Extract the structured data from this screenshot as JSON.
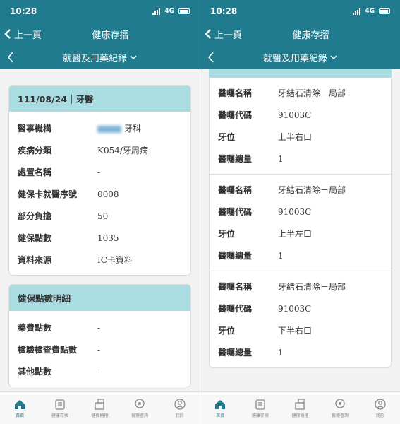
{
  "status": {
    "time": "10:28",
    "network": "4G"
  },
  "nav": {
    "back_label": "上一頁",
    "title": "健康存摺",
    "subtitle": "就醫及用藥紀錄"
  },
  "visit": {
    "header": "111/08/24｜牙醫",
    "fields": [
      {
        "label": "醫事機構",
        "value": "牙科"
      },
      {
        "label": "疾病分類",
        "value": "K054/牙周病"
      },
      {
        "label": "處置名稱",
        "value": "-"
      },
      {
        "label": "健保卡就醫序號",
        "value": "0008"
      },
      {
        "label": "部分負擔",
        "value": "50"
      },
      {
        "label": "健保點數",
        "value": "1035"
      },
      {
        "label": "資料來源",
        "value": "IC卡資料"
      }
    ]
  },
  "points": {
    "header": "健保點數明細",
    "fields": [
      {
        "label": "藥費點數",
        "value": "-"
      },
      {
        "label": "檢驗檢查費點數",
        "value": "-"
      },
      {
        "label": "其他點數",
        "value": "-"
      }
    ]
  },
  "orders_labels": {
    "name": "醫囑名稱",
    "code": "醫囑代碼",
    "tooth": "牙位",
    "total": "醫囑總量"
  },
  "orders": [
    {
      "name": "牙結石清除－局部",
      "code": "91003C",
      "tooth": "上半右口",
      "total": "1"
    },
    {
      "name": "牙結石清除－局部",
      "code": "91003C",
      "tooth": "上半左口",
      "total": "1"
    },
    {
      "name": "牙結石清除－局部",
      "code": "91003C",
      "tooth": "下半右口",
      "total": "1"
    }
  ],
  "tabs": [
    {
      "label": "首頁",
      "icon": "home-icon",
      "active": true
    },
    {
      "label": "健康存摺",
      "icon": "passbook-icon",
      "active": false
    },
    {
      "label": "健保櫃檯",
      "icon": "counter-icon",
      "active": false
    },
    {
      "label": "醫療查詢",
      "icon": "medical-search-icon",
      "active": false
    },
    {
      "label": "我的",
      "icon": "profile-icon",
      "active": false
    }
  ],
  "colors": {
    "primary": "#1f7b8d",
    "card_header": "#a9dde2",
    "link": "#3a7bbf"
  }
}
